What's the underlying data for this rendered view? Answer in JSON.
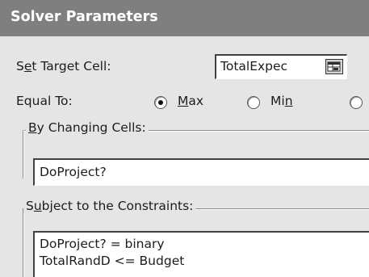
{
  "dialog": {
    "title": "Solver Parameters"
  },
  "target": {
    "label_pre": "S",
    "label_key": "e",
    "label_post": "t Target Cell:",
    "value": "TotalExpec"
  },
  "equal_to": {
    "label": "Equal To:",
    "max": {
      "key": "M",
      "rest": "ax",
      "selected": true
    },
    "min": {
      "pre": "Mi",
      "key": "n",
      "selected": false
    }
  },
  "changing": {
    "label_key": "B",
    "label_rest": "y Changing Cells:",
    "value": "DoProject?"
  },
  "constraints": {
    "label_pre": "S",
    "label_key": "u",
    "label_post": "bject to the Constraints:",
    "items": [
      "DoProject? = binary",
      "TotalRandD <= Budget"
    ]
  }
}
